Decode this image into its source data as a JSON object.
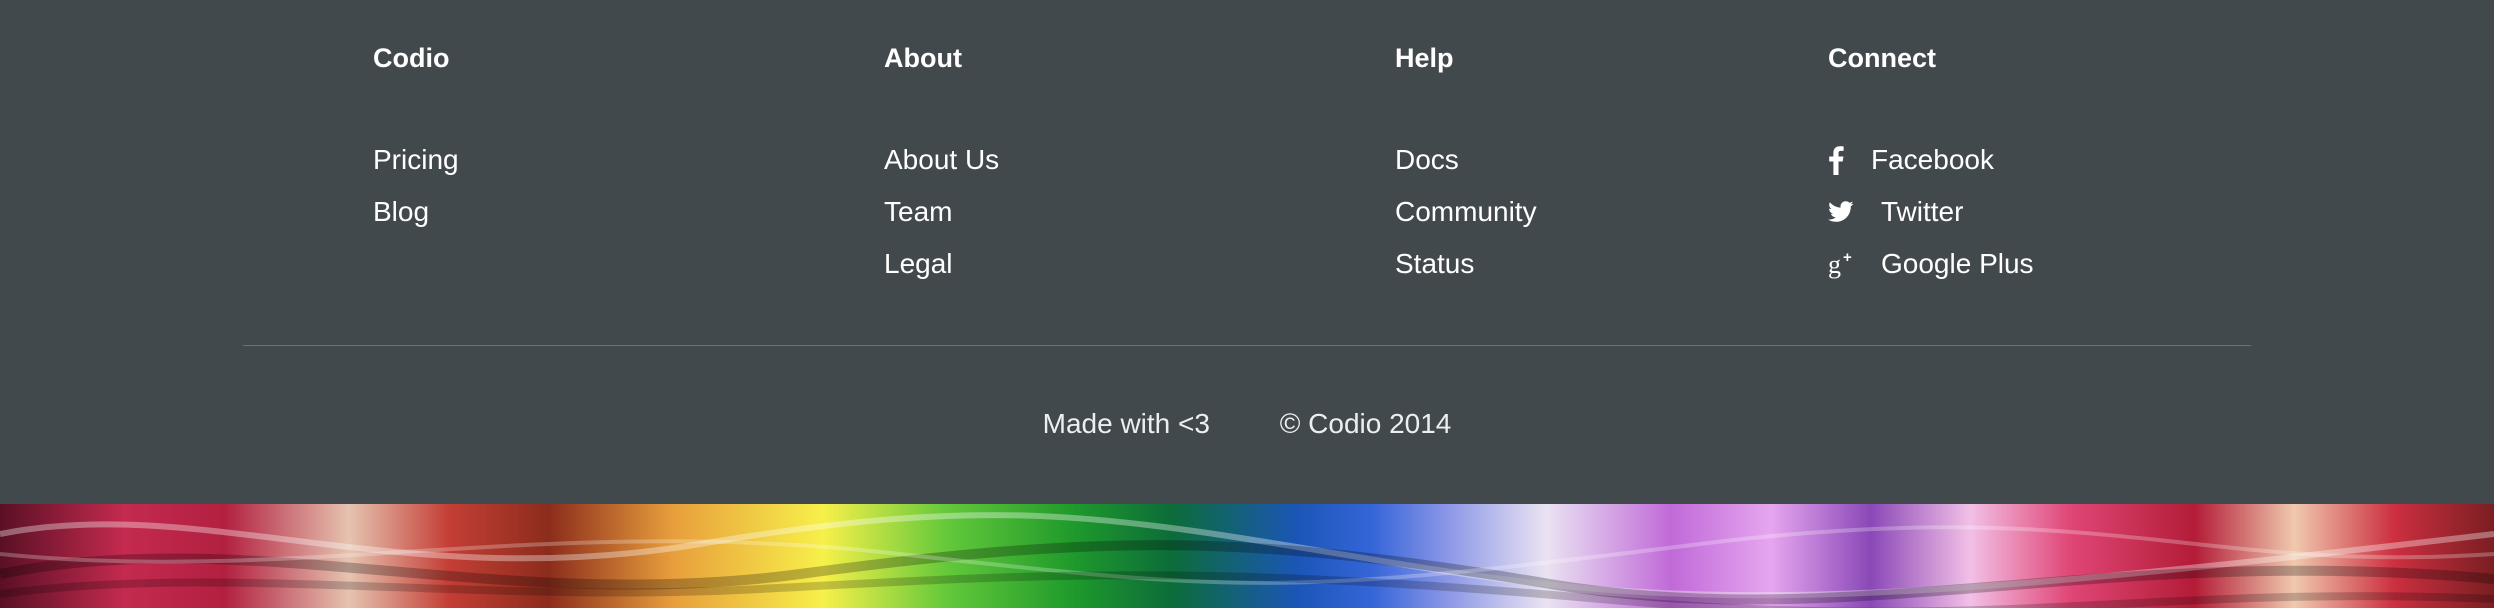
{
  "footer": {
    "columns": [
      {
        "heading": "Codio",
        "links": [
          "Pricing",
          "Blog"
        ]
      },
      {
        "heading": "About",
        "links": [
          "About Us",
          "Team",
          "Legal"
        ]
      },
      {
        "heading": "Help",
        "links": [
          "Docs",
          "Community",
          "Status"
        ]
      },
      {
        "heading": "Connect",
        "links": [
          {
            "icon": "facebook-icon",
            "label": "Facebook"
          },
          {
            "icon": "twitter-icon",
            "label": "Twitter"
          },
          {
            "icon": "google-plus-icon",
            "label": "Google Plus"
          }
        ]
      }
    ],
    "made_with": "Made with <3",
    "copyright": "© Codio 2014"
  },
  "colors": {
    "background": "#42494d",
    "text": "#ffffff",
    "divider": "#6a7276"
  }
}
